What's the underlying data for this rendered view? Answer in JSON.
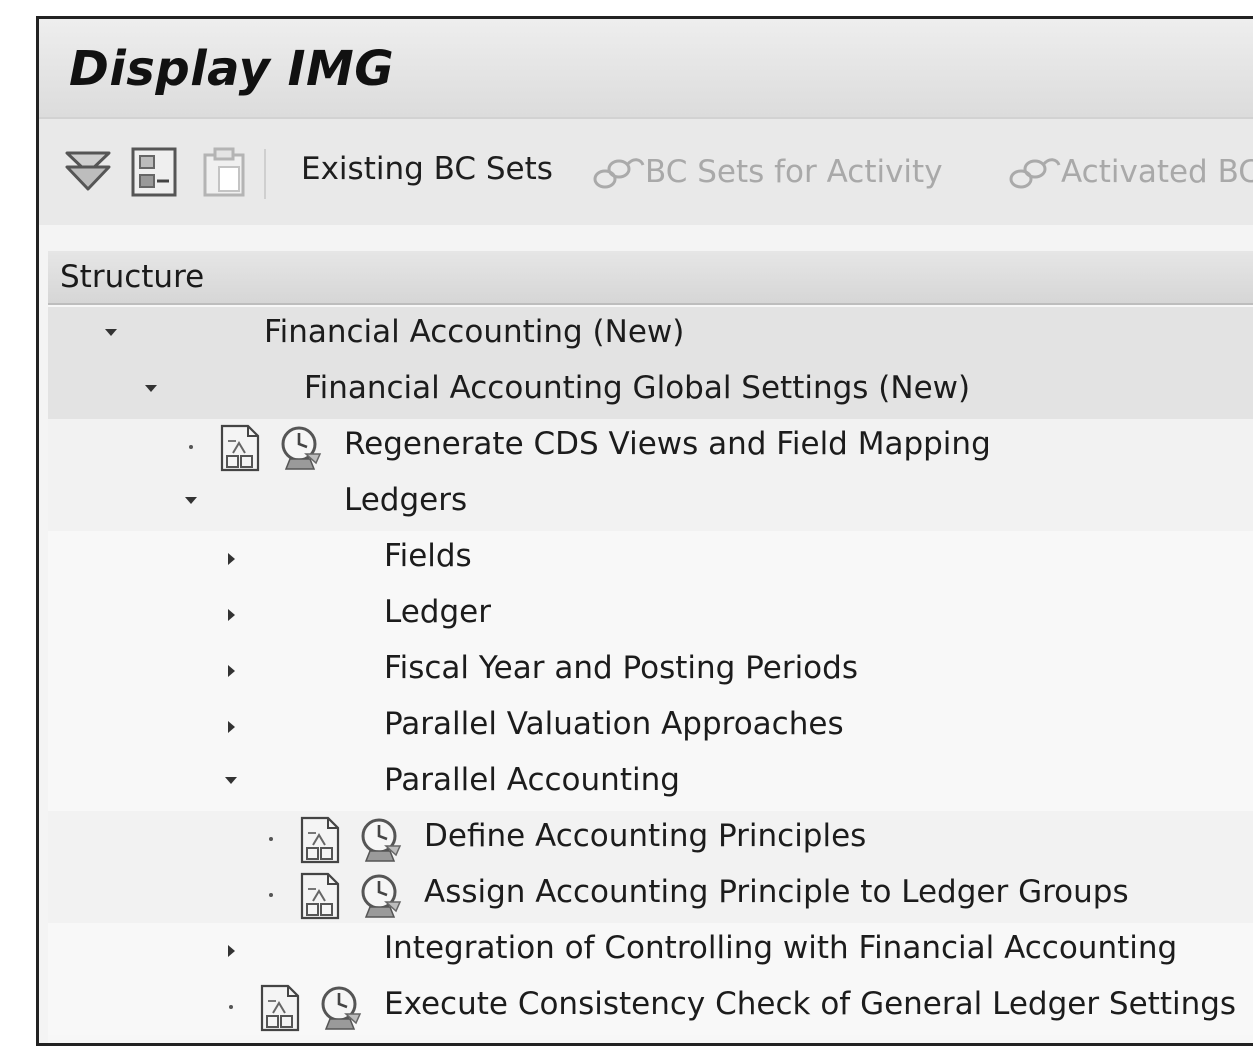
{
  "window": {
    "title": "Display IMG"
  },
  "toolbar": {
    "existing_bc_sets": "Existing BC Sets",
    "bc_sets_for_activity": "BC Sets for Activity",
    "activated_bc": "Activated BC"
  },
  "tree": {
    "header": "Structure",
    "rows": [
      {
        "label": "Financial Accounting (New)",
        "state": "expanded"
      },
      {
        "label": "Financial Accounting Global Settings (New)",
        "state": "expanded"
      },
      {
        "label": "Regenerate CDS Views and Field Mapping",
        "state": "activity"
      },
      {
        "label": "Ledgers",
        "state": "expanded"
      },
      {
        "label": "Fields",
        "state": "collapsed"
      },
      {
        "label": "Ledger",
        "state": "collapsed"
      },
      {
        "label": "Fiscal Year and Posting Periods",
        "state": "collapsed"
      },
      {
        "label": "Parallel Valuation Approaches",
        "state": "collapsed"
      },
      {
        "label": "Parallel Accounting",
        "state": "expanded"
      },
      {
        "label": "Define Accounting Principles",
        "state": "activity"
      },
      {
        "label": "Assign Accounting Principle to Ledger Groups",
        "state": "activity"
      },
      {
        "label": "Integration of Controlling with Financial Accounting",
        "state": "collapsed"
      },
      {
        "label": "Execute Consistency Check of General Ledger Settings",
        "state": "activity"
      }
    ]
  }
}
